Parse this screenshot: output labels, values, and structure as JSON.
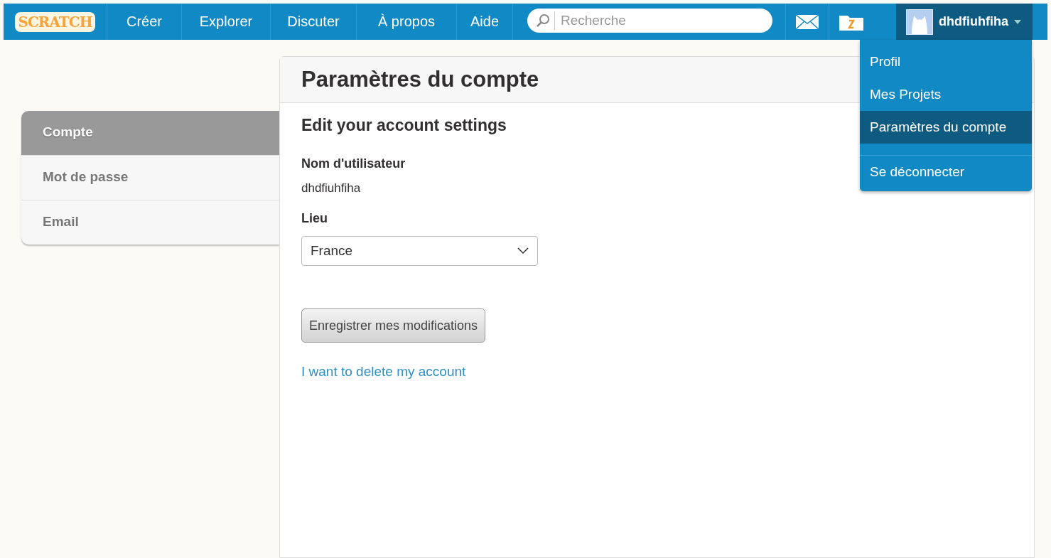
{
  "navbar": {
    "logo": "SCRATCH",
    "links": [
      "Créer",
      "Explorer",
      "Discuter",
      "À propos",
      "Aide"
    ],
    "search": {
      "placeholder": "Recherche"
    },
    "user": {
      "name": "dhdfiuhfiha",
      "menu_open": true
    }
  },
  "user_menu": [
    {
      "label": "Profil",
      "selected": false,
      "divider_before": false
    },
    {
      "label": "Mes Projets",
      "selected": false,
      "divider_before": false
    },
    {
      "label": "Paramètres du compte",
      "selected": true,
      "divider_before": false
    },
    {
      "label": "Se déconnecter",
      "selected": false,
      "divider_before": true
    }
  ],
  "sidebar": {
    "items": [
      {
        "label": "Compte",
        "selected": true
      },
      {
        "label": "Mot de passe",
        "selected": false
      },
      {
        "label": "Email",
        "selected": false
      }
    ]
  },
  "main": {
    "title": "Paramètres du compte",
    "subtitle": "Edit your account settings",
    "fields": [
      {
        "kind": "text",
        "label": "Nom d'utilisateur",
        "value": "dhdfiuhfiha"
      },
      {
        "kind": "select",
        "label": "Lieu",
        "value": "France"
      }
    ],
    "save_button": "Enregistrer mes modifications",
    "delete_link": "I want to delete my account"
  }
}
